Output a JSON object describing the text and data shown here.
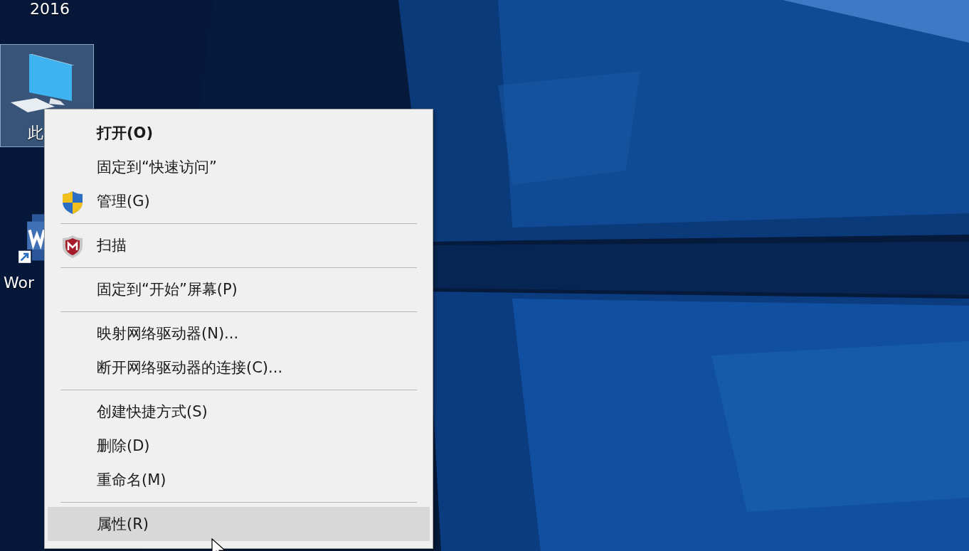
{
  "desktop": {
    "cut_label": "2016",
    "icons": [
      {
        "kind": "computer",
        "label": "此",
        "selected": true
      },
      {
        "kind": "word",
        "label": "Wor",
        "selected": false
      }
    ]
  },
  "context_menu": {
    "items": [
      {
        "kind": "item",
        "label": "打开(O)",
        "default": true,
        "selected": false
      },
      {
        "kind": "item",
        "label": "固定到“快速访问”",
        "default": false,
        "selected": false
      },
      {
        "kind": "shield-item",
        "label": "管理(G)",
        "default": false,
        "selected": false
      },
      {
        "kind": "separator"
      },
      {
        "kind": "scan-item",
        "label": "扫描",
        "default": false,
        "selected": false
      },
      {
        "kind": "separator"
      },
      {
        "kind": "item",
        "label": "固定到“开始”屏幕(P)",
        "default": false,
        "selected": false
      },
      {
        "kind": "separator"
      },
      {
        "kind": "item",
        "label": "映射网络驱动器(N)...",
        "default": false,
        "selected": false
      },
      {
        "kind": "item",
        "label": "断开网络驱动器的连接(C)...",
        "default": false,
        "selected": false
      },
      {
        "kind": "separator"
      },
      {
        "kind": "item",
        "label": "创建快捷方式(S)",
        "default": false,
        "selected": false
      },
      {
        "kind": "item",
        "label": "删除(D)",
        "default": false,
        "selected": false
      },
      {
        "kind": "item",
        "label": "重命名(M)",
        "default": false,
        "selected": false
      },
      {
        "kind": "separator"
      },
      {
        "kind": "item",
        "label": "属性(R)",
        "default": false,
        "selected": true
      }
    ]
  }
}
